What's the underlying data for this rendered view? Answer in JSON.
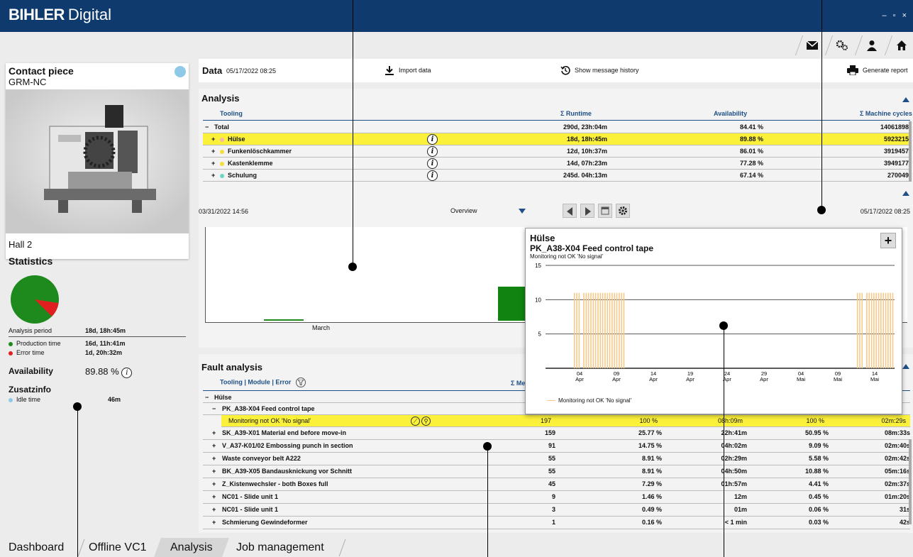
{
  "app": {
    "brand": "BIHLER",
    "title": "Digital",
    "window_controls": "– ▫ ×"
  },
  "top_icons": [
    "mail-icon",
    "settings-icon",
    "user-icon",
    "home-icon"
  ],
  "left": {
    "part_title": "Contact piece",
    "part_subtitle": "GRM-NC",
    "location": "Hall 2",
    "statistics_title": "Statistics",
    "analysis_period_label": "Analysis period",
    "analysis_period_value": "18d, 18h:45m",
    "production_label": "Production time",
    "production_value": "16d, 11h:41m",
    "error_label": "Error time",
    "error_value": "1d, 20h:32m",
    "availability_label": "Availability",
    "availability_value": "89.88 %",
    "zusatzinfo_label": "Zusatzinfo",
    "idle_label": "Idle time",
    "idle_value": "46m",
    "production_share": 0.8988
  },
  "databar": {
    "label": "Data",
    "date": "05/17/2022 08:25",
    "import_label": "Import data",
    "history_label": "Show message history",
    "report_label": "Generate report"
  },
  "analysis": {
    "title": "Analysis",
    "headers": {
      "tooling": "Tooling",
      "runtime": "Σ Runtime",
      "availability": "Availability",
      "cycles": "Σ Machine cycles"
    },
    "total": {
      "name": "Total",
      "runtime": "290d, 23h:04m",
      "availability": "84.41 %",
      "cycles": "14061898"
    },
    "rows": [
      {
        "name": "Hülse",
        "runtime": "18d, 18h:45m",
        "availability": "89.88 %",
        "cycles": "5923215",
        "color": "#f6b6a8"
      },
      {
        "name": "Funkenlöschkammer",
        "runtime": "12d, 10h:37m",
        "availability": "86.01 %",
        "cycles": "3919457",
        "color": "#f3de3c"
      },
      {
        "name": "Kastenklemme",
        "runtime": "14d, 07h:23m",
        "availability": "77.28 %",
        "cycles": "3949177",
        "color": "#f3de3c"
      },
      {
        "name": "Schulung",
        "runtime": "245d. 04h:13m",
        "availability": "67.14 %",
        "cycles": "270049",
        "color": "#6fd6c0"
      }
    ]
  },
  "timeline": {
    "start": "03/31/2022 14:56",
    "end": "05/17/2022 08:25",
    "view": "Overview",
    "month_label": "March"
  },
  "popup": {
    "title": "Hülse",
    "subtitle": "PK_A38-X04 Feed control tape",
    "caption": "Monitoring not OK 'No signal'",
    "legend": "Monitoring not OK 'No signal'"
  },
  "chart_data": {
    "type": "bar",
    "title": "PK_A38-X04 Feed control tape",
    "ylim": [
      0,
      15
    ],
    "y_ticks": [
      5,
      10,
      15
    ],
    "x_tick_labels": [
      {
        "day": "04",
        "month": "Apr"
      },
      {
        "day": "09",
        "month": "Apr"
      },
      {
        "day": "14",
        "month": "Apr"
      },
      {
        "day": "19",
        "month": "Apr"
      },
      {
        "day": "24",
        "month": "Apr"
      },
      {
        "day": "29",
        "month": "Apr"
      },
      {
        "day": "04",
        "month": "Mai"
      },
      {
        "day": "09",
        "month": "Mai"
      },
      {
        "day": "14",
        "month": "Mai"
      }
    ],
    "series": [
      {
        "name": "Monitoring not OK 'No signal'",
        "color": "#f7c98a",
        "values": [
          0,
          0,
          0,
          0,
          0,
          0,
          0,
          0,
          0,
          0,
          0,
          0,
          11,
          11,
          11,
          0,
          11,
          11,
          11,
          11,
          11,
          11,
          11,
          11,
          11,
          11,
          11,
          11,
          11,
          11,
          11,
          11,
          11,
          11,
          0,
          0,
          0,
          0,
          0,
          0,
          0,
          0,
          0,
          0,
          0,
          0,
          0,
          0,
          0,
          0,
          0,
          0,
          0,
          0,
          0,
          0,
          0,
          0,
          0,
          0,
          0,
          0,
          0,
          0,
          0,
          0,
          0,
          0,
          0,
          0,
          0,
          0,
          0,
          0,
          0,
          0,
          0,
          0,
          0,
          0,
          0,
          0,
          0,
          0,
          0,
          0,
          0,
          0,
          0,
          0,
          0,
          0,
          0,
          0,
          0,
          0,
          0,
          0,
          0,
          0,
          0,
          0,
          0,
          0,
          0,
          0,
          0,
          0,
          0,
          0,
          0,
          0,
          0,
          0,
          0,
          0,
          0,
          0,
          0,
          0,
          0,
          0,
          0,
          0,
          0,
          0,
          0,
          0,
          0,
          0,
          0,
          0,
          11,
          11,
          11,
          0,
          11,
          11,
          11,
          11,
          11,
          11,
          11,
          11,
          11,
          11,
          11,
          11
        ]
      }
    ]
  },
  "fault": {
    "title": "Fault analysis",
    "header_path": "Tooling | Module | Error",
    "header_m": "Σ Me",
    "group": "Hülse",
    "module": "PK_A38-X04 Feed control tape",
    "selected": {
      "name": "Monitoring not OK 'No signal'",
      "count": "197",
      "share": "100 %",
      "duration": "08h:09m",
      "share2": "100 %",
      "avg": "02m:29s"
    },
    "rows": [
      {
        "name": "SK_A39-X01 Material end before move-in",
        "count": "159",
        "share": "25.77 %",
        "duration": "22h:41m",
        "share2": "50.95 %",
        "avg": "08m:33s"
      },
      {
        "name": "V_A37-K01/02 Embossing punch in section",
        "count": "91",
        "share": "14.75 %",
        "duration": "04h:02m",
        "share2": "9.09 %",
        "avg": "02m:40s"
      },
      {
        "name": "Waste conveyor belt A222",
        "count": "55",
        "share": "8.91 %",
        "duration": "02h:29m",
        "share2": "5.58 %",
        "avg": "02m:42s"
      },
      {
        "name": "BK_A39-X05 Bandausknickung vor Schnitt",
        "count": "55",
        "share": "8.91 %",
        "duration": "04h:50m",
        "share2": "10.88 %",
        "avg": "05m:16s"
      },
      {
        "name": "Z_Kistenwechsler - both Boxes full",
        "count": "45",
        "share": "7.29 %",
        "duration": "01h:57m",
        "share2": "4.41 %",
        "avg": "02m:37s"
      },
      {
        "name": "NC01 - Slide unit 1",
        "count": "9",
        "share": "1.46 %",
        "duration": "12m",
        "share2": "0.45 %",
        "avg": "01m:20s"
      },
      {
        "name": "NC01 - Slide unit 1",
        "count": "3",
        "share": "0.49 %",
        "duration": "01m",
        "share2": "0.06 %",
        "avg": "31s"
      },
      {
        "name": "Schmierung Gewindeformer",
        "count": "1",
        "share": "0.16 %",
        "duration": "< 1 min",
        "share2": "0.03 %",
        "avg": "42s"
      }
    ]
  },
  "tabs": [
    "Dashboard",
    "Offline VC1",
    "Analysis",
    "Job management"
  ],
  "colors": {
    "navy": "#0e3a6e",
    "highlight": "#fbf03a",
    "production": "#1e8a1e",
    "error": "#e02020",
    "bars": "#f7c98a"
  }
}
